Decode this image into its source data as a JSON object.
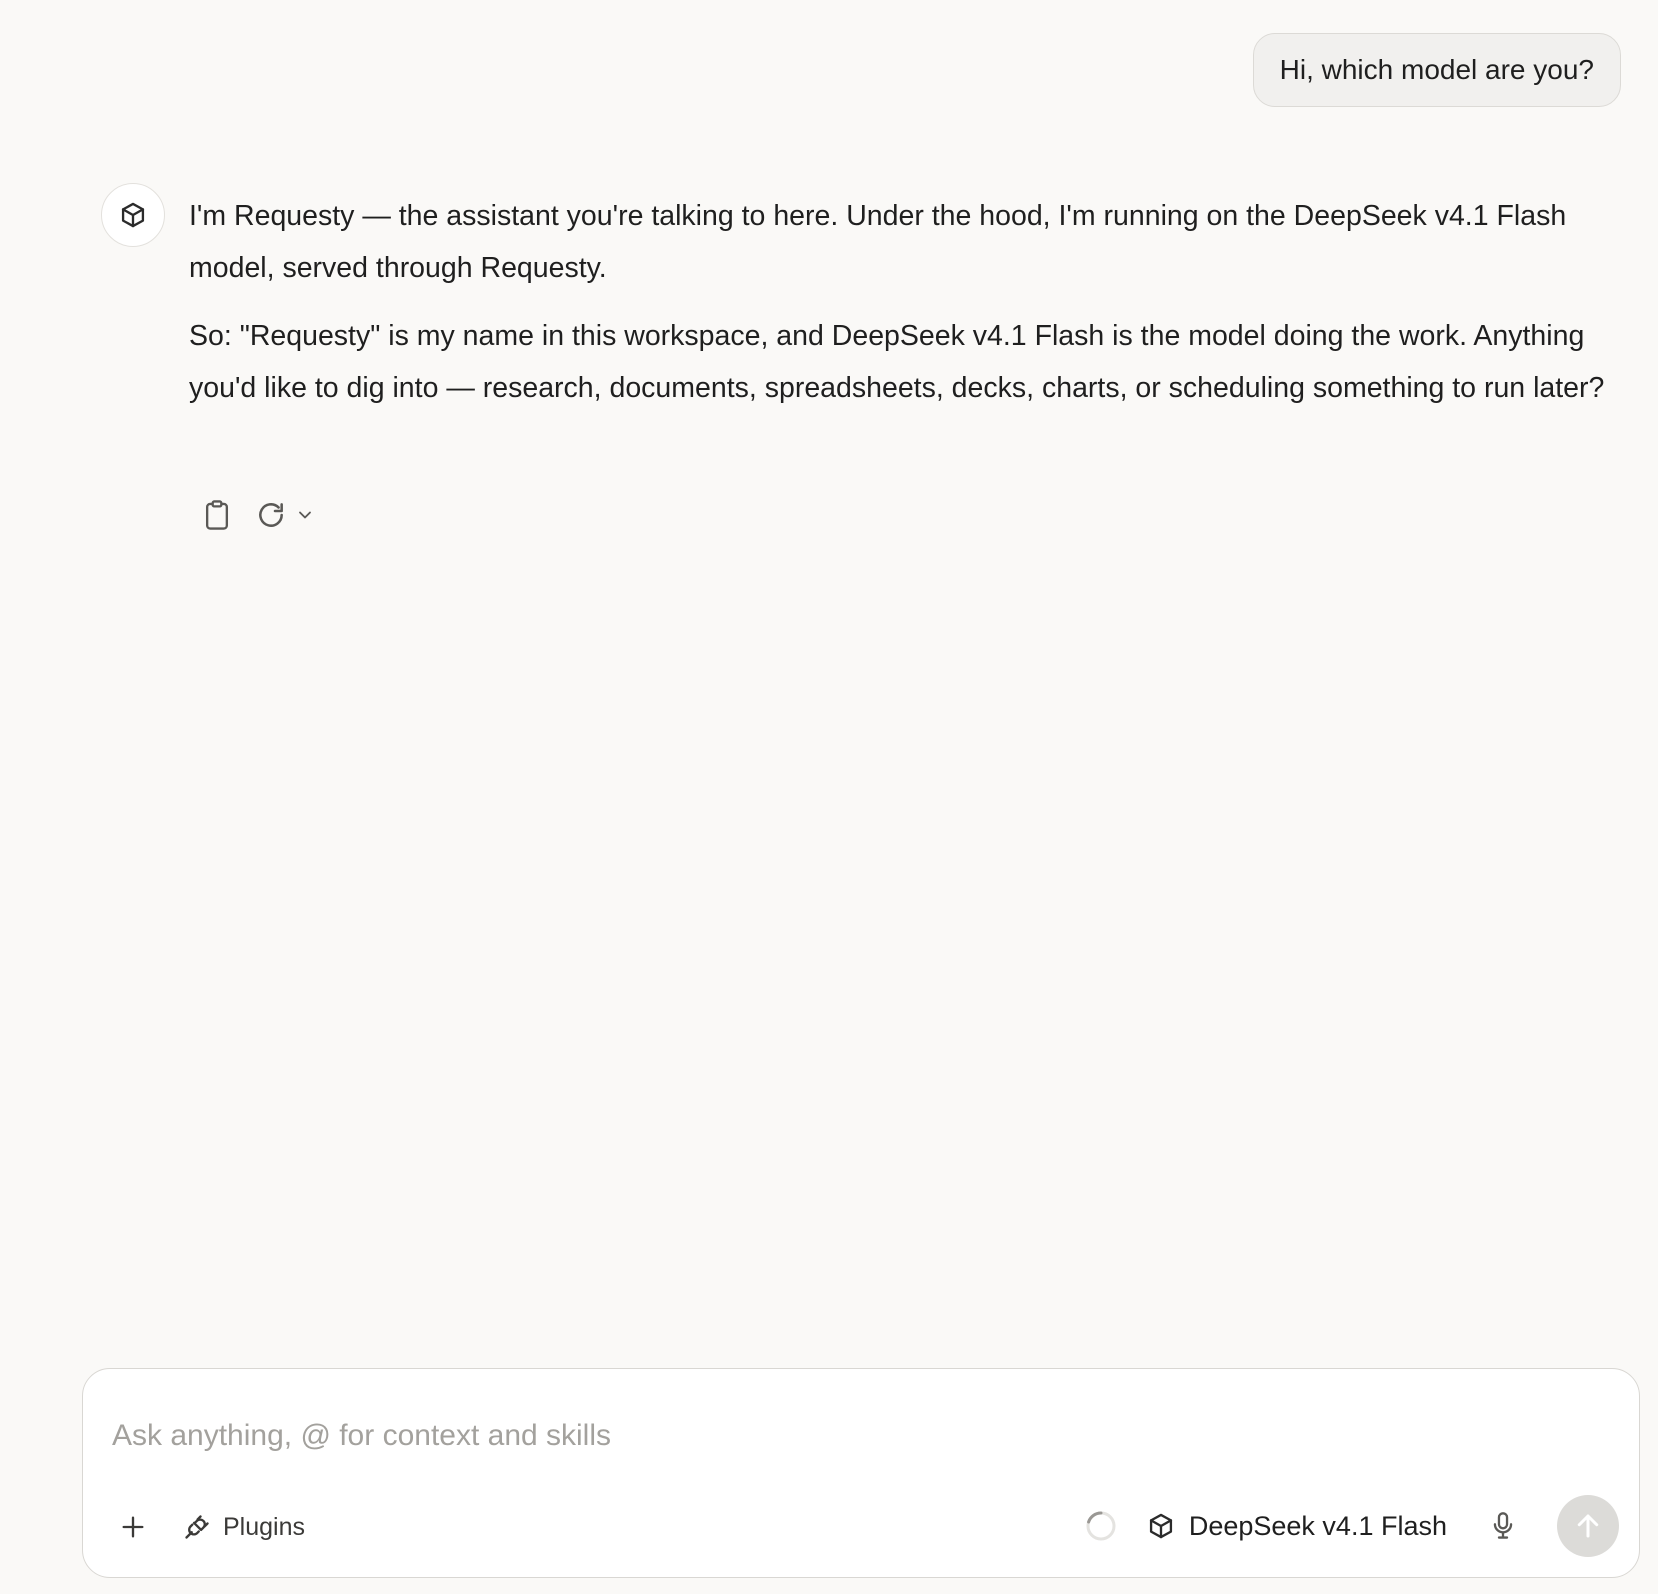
{
  "conversation": {
    "user_message": "Hi, which model are you?",
    "assistant": {
      "avatar_icon": "cube-icon",
      "paragraphs": [
        "I'm Requesty — the assistant you're talking to here. Under the hood, I'm running on the DeepSeek v4.1 Flash model, served through Requesty.",
        "So: \"Requesty\" is my name in this workspace, and DeepSeek v4.1 Flash is the model doing the work. Anything you'd like to dig into — research, documents, spreadsheets, decks, charts, or scheduling something to run later?"
      ],
      "actions": {
        "copy_icon": "clipboard-icon",
        "regenerate_icon": "refresh-icon",
        "more_icon": "chevron-down-icon"
      }
    }
  },
  "composer": {
    "placeholder": "Ask anything, @ for context and skills",
    "value": "",
    "attach_icon": "plus-icon",
    "plugins_label": "Plugins",
    "plugins_icon": "plug-icon",
    "status_icon": "loading-spinner-icon",
    "model_icon": "cube-icon",
    "model_name": "DeepSeek v4.1 Flash",
    "mic_icon": "microphone-icon",
    "send_icon": "arrow-up-icon"
  },
  "colors": {
    "background": "#faf9f7",
    "user_bubble": "#f1f0ee",
    "text": "#1f1f1f",
    "placeholder": "#a3a19d",
    "send_button": "#dcdbd8"
  }
}
